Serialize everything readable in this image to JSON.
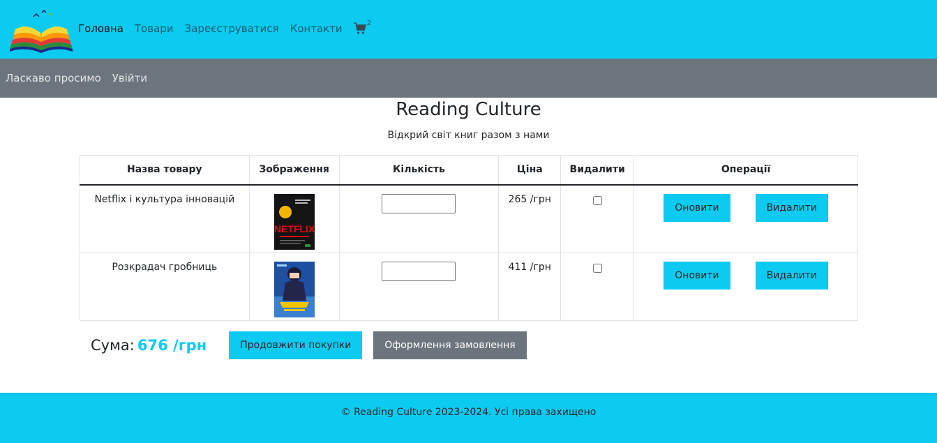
{
  "header": {
    "logo_icon": "open-book-logo",
    "nav": [
      {
        "label": "Головна",
        "active": true
      },
      {
        "label": "Товари",
        "active": false
      },
      {
        "label": "Зареєструватися",
        "active": false
      },
      {
        "label": "Контакти",
        "active": false
      }
    ],
    "cart": {
      "icon": "shopping-cart-icon",
      "count": "2"
    },
    "accent_color": "#0dcaf0"
  },
  "subbar": {
    "links": [
      "Ласкаво просимо",
      "Увійти"
    ],
    "background": "#6c757d"
  },
  "main": {
    "title": "Reading Culture",
    "subtitle": "Відкрий світ книг разом з нами"
  },
  "table": {
    "columns": [
      "Назва товару",
      "Зображення",
      "Кількість",
      "Ціна",
      "Видалити",
      "Операції"
    ],
    "rows": [
      {
        "name": "Netflix і культура інновацій",
        "image": "netflix-book-cover",
        "quantity": "",
        "price": "265 /грн",
        "delete_checked": false,
        "update_label": "Оновити",
        "remove_label": "Видалити"
      },
      {
        "name": "Розкрадач гробниць",
        "image": "tomb-raider-book-cover",
        "quantity": "",
        "price": "411 /грн",
        "delete_checked": false,
        "update_label": "Оновити",
        "remove_label": "Видалити"
      }
    ]
  },
  "summary": {
    "label": "Сума:",
    "value": "676 /грн",
    "continue_label": "Продовжити покупки",
    "checkout_label": "Оформлення замовлення"
  },
  "footer": {
    "text": "© Reading Culture 2023-2024. Усі права захищено"
  }
}
